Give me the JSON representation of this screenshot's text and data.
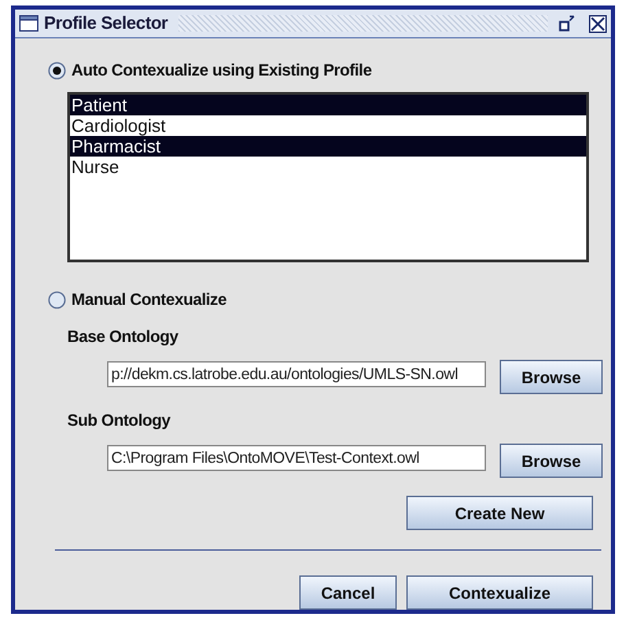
{
  "window": {
    "title": "Profile Selector"
  },
  "modes": [
    {
      "label": "Auto Contexualize using Existing Profile",
      "selected": true
    },
    {
      "label": "Manual Contexualize",
      "selected": false
    }
  ],
  "profiles": [
    {
      "label": "Patient",
      "selected": true
    },
    {
      "label": "Cardiologist",
      "selected": false
    },
    {
      "label": "Pharmacist",
      "selected": true
    },
    {
      "label": "Nurse",
      "selected": false
    }
  ],
  "ontologies": [
    {
      "label": "Base Ontology",
      "value": "p://dekm.cs.latrobe.edu.au/ontologies/UMLS-SN.owl",
      "button": "Browse"
    },
    {
      "label": "Sub Ontology",
      "value": "C:\\Program Files\\OntoMOVE\\Test-Context.owl",
      "button": "Browse"
    }
  ],
  "create_button": "Create New",
  "buttons": [
    "Cancel",
    "Contexualize"
  ]
}
